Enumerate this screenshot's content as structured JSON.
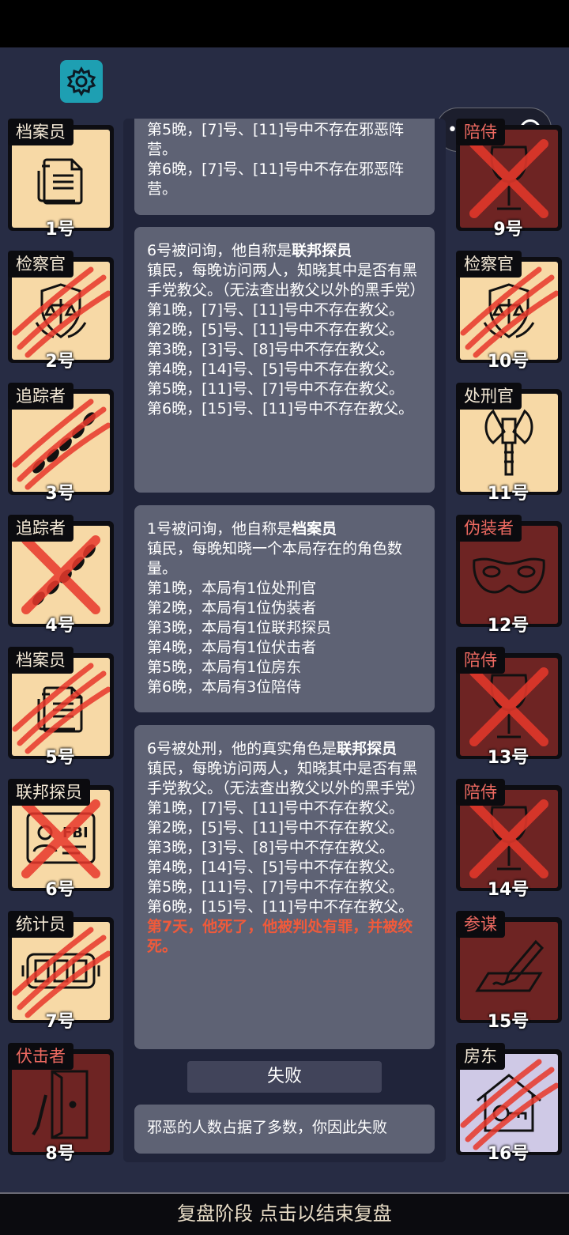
{
  "app": {
    "settings_icon": "gear-icon",
    "capsule_icons": [
      "more-dots-icon",
      "close-target-icon"
    ]
  },
  "colors": {
    "good": "#f7d9a6",
    "evil": "#6e2423",
    "landlord": "#cfc9e6",
    "evil_label": "#ee6a61",
    "accent_red": "#ef5a3b"
  },
  "players": [
    {
      "role": "档案员",
      "number": "1号",
      "team": "good",
      "icon": "documents-icon",
      "mark": "none"
    },
    {
      "role": "检察官",
      "number": "2号",
      "team": "good",
      "icon": "scales-badge-icon",
      "mark": "claw"
    },
    {
      "role": "追踪者",
      "number": "3号",
      "team": "good",
      "icon": "footprints-icon",
      "mark": "claw"
    },
    {
      "role": "追踪者",
      "number": "4号",
      "team": "good",
      "icon": "footprints-icon",
      "mark": "cross"
    },
    {
      "role": "档案员",
      "number": "5号",
      "team": "good",
      "icon": "documents-icon",
      "mark": "claw"
    },
    {
      "role": "联邦探员",
      "number": "6号",
      "team": "good",
      "icon": "fbi-badge-icon",
      "mark": "cross"
    },
    {
      "role": "统计员",
      "number": "7号",
      "team": "good",
      "icon": "counter-icon",
      "mark": "claw"
    },
    {
      "role": "伏击者",
      "number": "8号",
      "team": "evil",
      "icon": "door-knife-icon",
      "mark": "none"
    },
    {
      "role": "陪侍",
      "number": "9号",
      "team": "evil",
      "icon": "wine-glass-icon",
      "mark": "cross"
    },
    {
      "role": "检察官",
      "number": "10号",
      "team": "good",
      "icon": "scales-badge-icon",
      "mark": "claw"
    },
    {
      "role": "处刑官",
      "number": "11号",
      "team": "good",
      "icon": "axe-icon",
      "mark": "none"
    },
    {
      "role": "伪装者",
      "number": "12号",
      "team": "evil",
      "icon": "mask-icon",
      "mark": "none"
    },
    {
      "role": "陪侍",
      "number": "13号",
      "team": "evil",
      "icon": "wine-glass-icon",
      "mark": "cross"
    },
    {
      "role": "陪侍",
      "number": "14号",
      "team": "evil",
      "icon": "wine-glass-icon",
      "mark": "cross"
    },
    {
      "role": "参谋",
      "number": "15号",
      "team": "evil",
      "icon": "pen-paper-icon",
      "mark": "none"
    },
    {
      "role": "房东",
      "number": "16号",
      "team": "lav",
      "icon": "house-key-icon",
      "mark": "claw"
    }
  ],
  "log": {
    "entry0": {
      "lines": [
        "第5晚，[7]号、[11]号中不存在邪恶阵营。",
        "第6晚，[7]号、[11]号中不存在邪恶阵营。"
      ]
    },
    "entry1": {
      "head": "6号被问询，他自称是",
      "claim": "联邦探员",
      "lines": [
        "镇民，每晚访问两人，知晓其中是否有黑手党教父。（无法查出教父以外的黑手党）",
        "第1晚，[7]号、[11]号中不存在教父。",
        "第2晚，[5]号、[11]号中不存在教父。",
        "第3晚，[3]号、[8]号中不存在教父。",
        "第4晚，[14]号、[5]号中不存在教父。",
        "第5晚，[11]号、[7]号中不存在教父。",
        "第6晚，[15]号、[11]号中不存在教父。"
      ]
    },
    "entry2": {
      "head": "1号被问询，他自称是",
      "claim": "档案员",
      "lines": [
        "镇民，每晚知晓一个本局存在的角色数量。",
        "第1晚，本局有1位处刑官",
        "第2晚，本局有1位伪装者",
        "第3晚，本局有1位联邦探员",
        "第4晚，本局有1位伏击者",
        "第5晚，本局有1位房东",
        "第6晚，本局有3位陪侍"
      ]
    },
    "entry3": {
      "head": "6号被处刑，他的真实角色是",
      "claim": "联邦探员",
      "lines": [
        "镇民，每晚访问两人，知晓其中是否有黑手党教父。（无法查出教父以外的黑手党）",
        "第1晚，[7]号、[11]号中不存在教父。",
        "第2晚，[5]号、[11]号中不存在教父。",
        "第3晚，[3]号、[8]号中不存在教父。",
        "第4晚，[14]号、[5]号中不存在教父。",
        "第5晚，[11]号、[7]号中不存在教父。",
        "第6晚，[15]号、[11]号中不存在教父。"
      ],
      "verdict": "第7天，他死了，他被判处有罪，并被绞死。"
    },
    "result_label": "失败",
    "final_message": "邪恶的人数占据了多数，你因此失败"
  },
  "footer": {
    "label": "复盘阶段 点击以结束复盘"
  }
}
